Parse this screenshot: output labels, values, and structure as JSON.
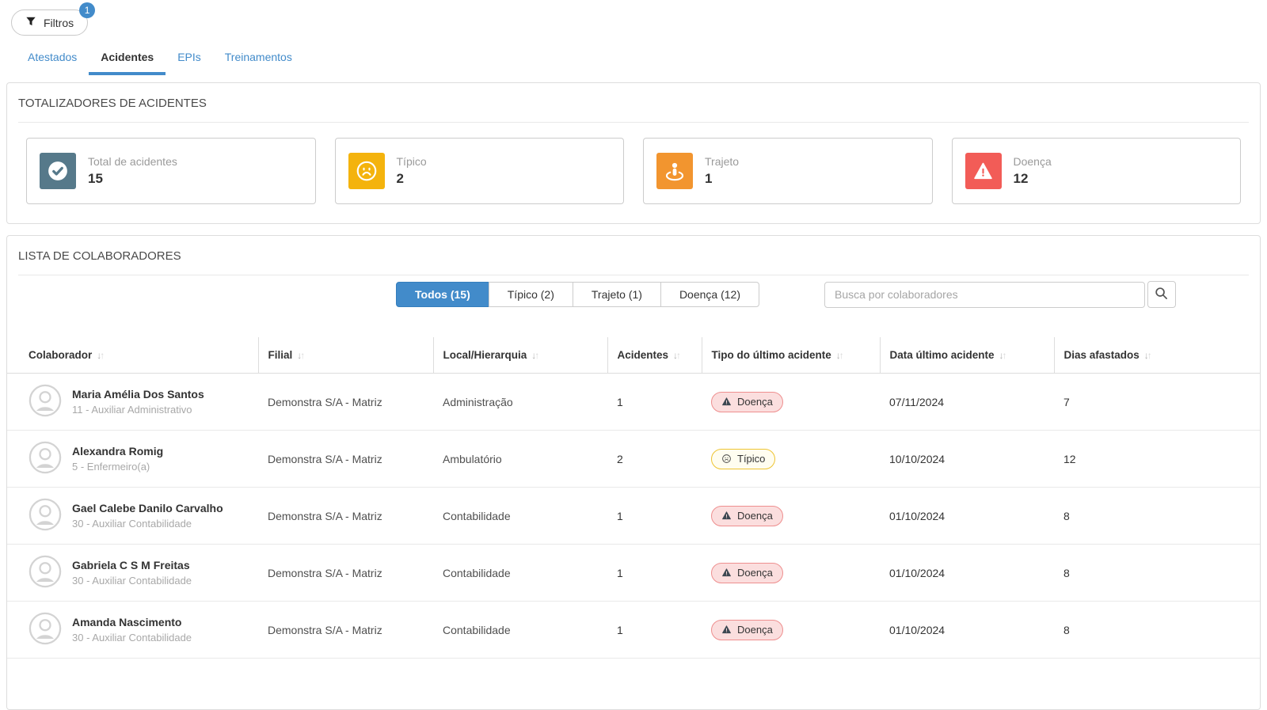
{
  "filters": {
    "label": "Filtros",
    "badge": "1"
  },
  "tabs": {
    "items": [
      {
        "id": "atestados",
        "label": "Atestados",
        "active": false
      },
      {
        "id": "acidentes",
        "label": "Acidentes",
        "active": true
      },
      {
        "id": "epis",
        "label": "EPIs",
        "active": false
      },
      {
        "id": "treinamentos",
        "label": "Treinamentos",
        "active": false
      }
    ]
  },
  "colors": {
    "primary": "#428bca"
  },
  "totalizers": {
    "title": "TOTALIZADORES DE ACIDENTES",
    "cards": [
      {
        "id": "total",
        "label": "Total de acidentes",
        "value": "15",
        "icon": "check-circle-icon",
        "color": "#56798a"
      },
      {
        "id": "tipico",
        "label": "Típico",
        "value": "2",
        "icon": "sad-face-icon",
        "color": "#f4b30d"
      },
      {
        "id": "trajeto",
        "label": "Trajeto",
        "value": "1",
        "icon": "person-route-icon",
        "color": "#f2952f"
      },
      {
        "id": "doenca",
        "label": "Doença",
        "value": "12",
        "icon": "warning-triangle-icon",
        "color": "#f25c57"
      }
    ]
  },
  "list": {
    "title": "LISTA DE COLABORADORES",
    "filter_buttons": [
      {
        "id": "todos",
        "label": "Todos (15)",
        "active": true
      },
      {
        "id": "tipico",
        "label": "Típico (2)",
        "active": false
      },
      {
        "id": "trajeto",
        "label": "Trajeto (1)",
        "active": false
      },
      {
        "id": "doenca",
        "label": "Doença (12)",
        "active": false
      }
    ],
    "search": {
      "placeholder": "Busca por colaboradores"
    },
    "table": {
      "columns": [
        {
          "id": "colaborador",
          "label": "Colaborador"
        },
        {
          "id": "filial",
          "label": "Filial"
        },
        {
          "id": "local-hierarquia",
          "label": "Local/Hierarquia"
        },
        {
          "id": "acidentes",
          "label": "Acidentes"
        },
        {
          "id": "tipo-ultimo-acidente",
          "label": "Tipo do último acidente"
        },
        {
          "id": "data-ultimo-acidente",
          "label": "Data último acidente"
        },
        {
          "id": "dias-afastados",
          "label": "Dias afastados"
        }
      ],
      "rows": [
        {
          "name": "Maria Amélia Dos Santos",
          "role": "11 - Auxiliar Administrativo",
          "branch": "Demonstra S/A - Matriz",
          "location": "Administração",
          "accidents": "1",
          "last_accident_type": "Doença",
          "last_accident_style": "doenca",
          "last_accident_date": "07/11/2024",
          "days_off": "7"
        },
        {
          "name": "Alexandra Romig",
          "role": "5 - Enfermeiro(a)",
          "branch": "Demonstra S/A - Matriz",
          "location": "Ambulatório",
          "accidents": "2",
          "last_accident_type": "Típico",
          "last_accident_style": "tipico",
          "last_accident_date": "10/10/2024",
          "days_off": "12"
        },
        {
          "name": "Gael Calebe Danilo Carvalho",
          "role": "30 - Auxiliar Contabilidade",
          "branch": "Demonstra S/A - Matriz",
          "location": "Contabilidade",
          "accidents": "1",
          "last_accident_type": "Doença",
          "last_accident_style": "doenca",
          "last_accident_date": "01/10/2024",
          "days_off": "8"
        },
        {
          "name": "Gabriela C S M Freitas",
          "role": "30 - Auxiliar Contabilidade",
          "branch": "Demonstra S/A - Matriz",
          "location": "Contabilidade",
          "accidents": "1",
          "last_accident_type": "Doença",
          "last_accident_style": "doenca",
          "last_accident_date": "01/10/2024",
          "days_off": "8"
        },
        {
          "name": "Amanda Nascimento",
          "role": "30 - Auxiliar Contabilidade",
          "branch": "Demonstra S/A - Matriz",
          "location": "Contabilidade",
          "accidents": "1",
          "last_accident_type": "Doença",
          "last_accident_style": "doenca",
          "last_accident_date": "01/10/2024",
          "days_off": "8"
        }
      ]
    }
  },
  "badge_styles": {
    "doenca": {
      "background": "#fbdede",
      "border": "#ee8f8f",
      "icon_color": "#3d4852",
      "icon": "warning-triangle-icon"
    },
    "tipico": {
      "background": "#fffdf0",
      "border": "#eec431",
      "icon_color": "#4a4a4a",
      "icon": "sad-face-icon"
    }
  }
}
